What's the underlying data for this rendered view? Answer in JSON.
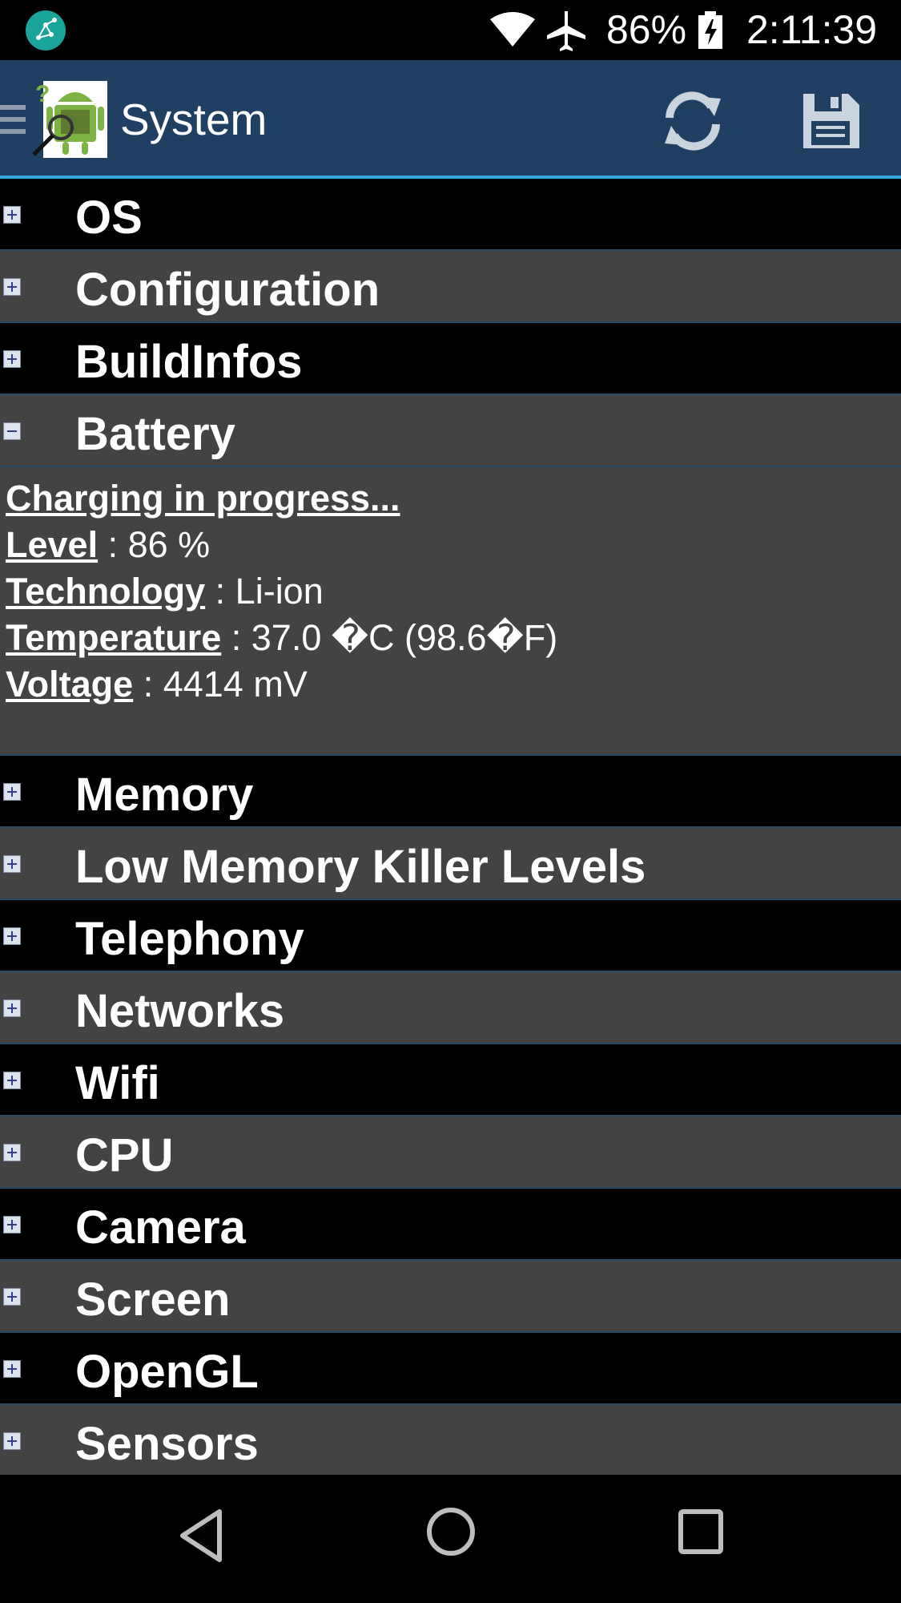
{
  "status_bar": {
    "battery_percent": "86%",
    "time": "2:11:39",
    "icons": [
      "app-notification-icon",
      "wifi-icon",
      "airplane-mode-icon",
      "battery-charging-icon"
    ]
  },
  "action_bar": {
    "title": "System",
    "icons": [
      "menu-icon",
      "app-logo",
      "refresh-icon",
      "save-icon"
    ]
  },
  "sections": [
    {
      "label": "OS",
      "expanded": false
    },
    {
      "label": "Configuration",
      "expanded": false
    },
    {
      "label": "BuildInfos",
      "expanded": false
    },
    {
      "label": "Battery",
      "expanded": true
    },
    {
      "label": "Memory",
      "expanded": false
    },
    {
      "label": "Low Memory Killer Levels",
      "expanded": false
    },
    {
      "label": "Telephony",
      "expanded": false
    },
    {
      "label": "Networks",
      "expanded": false
    },
    {
      "label": "Wifi",
      "expanded": false
    },
    {
      "label": "CPU",
      "expanded": false
    },
    {
      "label": "Camera",
      "expanded": false
    },
    {
      "label": "Screen",
      "expanded": false
    },
    {
      "label": "OpenGL",
      "expanded": false
    },
    {
      "label": "Sensors",
      "expanded": false
    }
  ],
  "battery": {
    "status": "Charging in progress...",
    "level_key": "Level",
    "level_value": " : 86 %",
    "technology_key": "Technology",
    "technology_value": " : Li-ion",
    "temperature_key": "Temperature",
    "temperature_value": " : 37.0 �C (98.6�F)",
    "voltage_key": "Voltage",
    "voltage_value": " : 4414 mV"
  },
  "nav_bar": {
    "icons": [
      "back-icon",
      "home-icon",
      "recents-icon"
    ]
  }
}
